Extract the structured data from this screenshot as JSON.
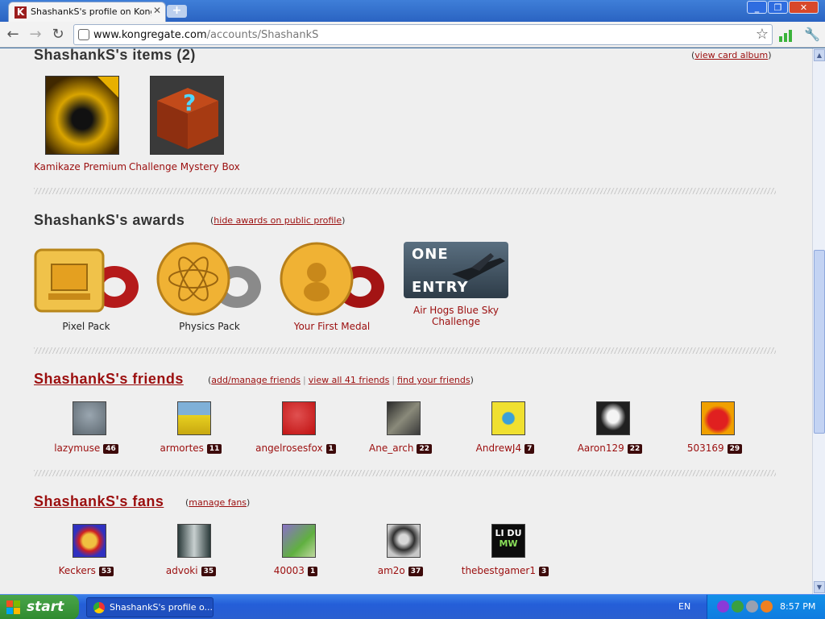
{
  "browser": {
    "tab_title": "ShashankS's profile on Kongre",
    "tab_favicon": "K",
    "url_host": "www.kongregate.com",
    "url_path": "/accounts/ShashankS"
  },
  "items_section": {
    "title": "ShashankS's items (2)",
    "link_open": "(",
    "link": "view card album",
    "link_close": ")",
    "items": [
      {
        "name": "Kamikaze Premium"
      },
      {
        "name": "Challenge Mystery Box"
      }
    ]
  },
  "awards_section": {
    "title": "ShashankS's awards",
    "link_open": "(",
    "link": "hide awards on public profile",
    "link_close": ")",
    "awards": [
      {
        "name": "Pixel Pack"
      },
      {
        "name": "Physics Pack"
      },
      {
        "name": "Your First Medal"
      },
      {
        "name": "Air Hogs Blue Sky Challenge",
        "badge_top": "ONE",
        "badge_bottom": "ENTRY"
      }
    ]
  },
  "friends_section": {
    "title": "ShashankS's friends",
    "link_open": "(",
    "link1": "add/manage friends",
    "sep": "|",
    "link2": "view all 41 friends",
    "link3": "find your friends",
    "link_close": ")",
    "friends": [
      {
        "name": "lazymuse",
        "level": "46"
      },
      {
        "name": "armortes",
        "level": "11"
      },
      {
        "name": "angelrosesfox",
        "level": "1"
      },
      {
        "name": "Ane_arch",
        "level": "22"
      },
      {
        "name": "AndrewJ4",
        "level": "7"
      },
      {
        "name": "Aaron129",
        "level": "22"
      },
      {
        "name": "503169",
        "level": "29"
      }
    ]
  },
  "fans_section": {
    "title": "ShashankS's fans",
    "link_open": "(",
    "link": "manage fans",
    "link_close": ")",
    "fans": [
      {
        "name": "Keckers",
        "level": "53"
      },
      {
        "name": "advoki",
        "level": "35"
      },
      {
        "name": "40003",
        "level": "1"
      },
      {
        "name": "am2o",
        "level": "37"
      },
      {
        "name": "thebestgamer1",
        "level": "3"
      }
    ],
    "logo_text_top": "LI DU",
    "logo_text_bottom": "MW"
  },
  "taskbar": {
    "start": "start",
    "task_title": "ShashankS's profile o...",
    "lang": "EN",
    "clock": "8:57 PM"
  }
}
